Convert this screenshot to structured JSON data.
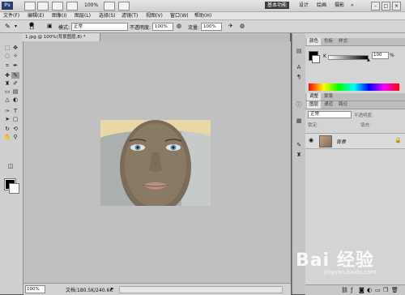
{
  "app": {
    "logo": "Ps",
    "zoom": "100%",
    "workspaces": [
      "基本功能",
      "设计",
      "绘画",
      "摄影"
    ],
    "window_buttons": [
      "–",
      "□",
      "×"
    ]
  },
  "menu": [
    "文件(F)",
    "编辑(E)",
    "图像(I)",
    "图层(L)",
    "选择(S)",
    "滤镜(T)",
    "视图(V)",
    "窗口(W)",
    "帮助(H)"
  ],
  "options": {
    "brush_size": "13",
    "mode_label": "模式:",
    "mode_value": "正常",
    "opacity_label": "不透明度:",
    "opacity_value": "100%",
    "flow_label": "流量:",
    "flow_value": "100%"
  },
  "document": {
    "tab_title": "1.jpg @ 100%(背景图层,8) *",
    "status_zoom": "100%",
    "status_doc": "文档:180.5K/240.6K"
  },
  "panels": {
    "color_tabs": [
      "颜色",
      "色板",
      "样式"
    ],
    "k_label": "K",
    "k_value": "100",
    "k_unit": "%",
    "adjust_tabs": [
      "调整",
      "蒙版"
    ],
    "layers_tabs": [
      "图层",
      "通道",
      "路径"
    ],
    "blend_mode": "正常",
    "opacity_label": "不透明度:",
    "fill_label": "填充:",
    "lock_label": "锁定:",
    "layer_name": "背景"
  },
  "watermark": {
    "text": "Bai 经验",
    "sub": "jingyan.baidu.com"
  },
  "colors": {
    "accent": "#3c3c3c",
    "canvas_bg": "#c0c0c0"
  }
}
